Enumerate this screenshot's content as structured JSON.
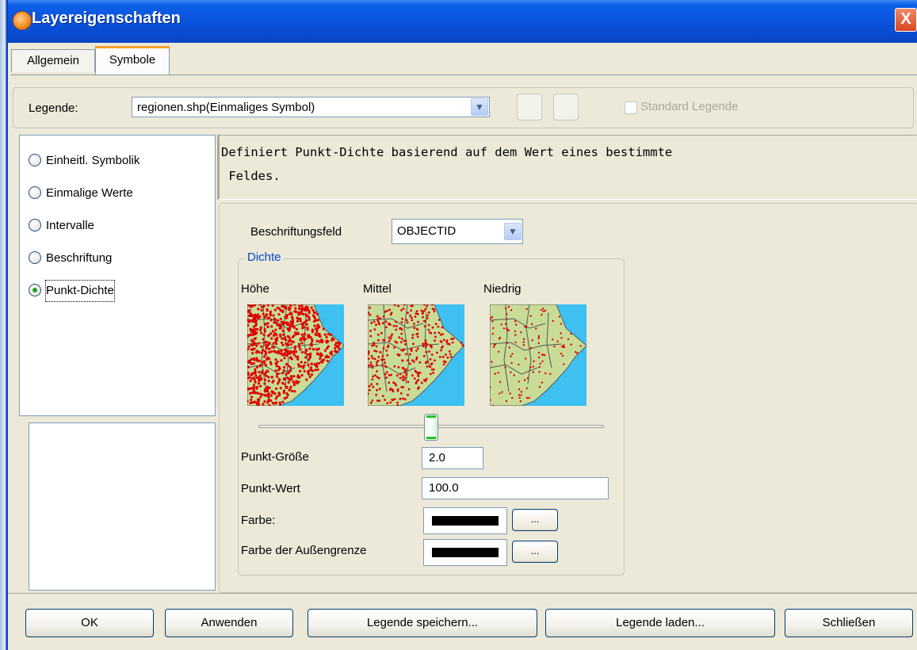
{
  "window": {
    "title": "Layereigenschaften",
    "close_glyph": "X"
  },
  "tabs": [
    {
      "label": "Allgemein"
    },
    {
      "label": "Symbole"
    }
  ],
  "legend": {
    "label": "Legende:",
    "value": "regionen.shp(Einmaliges Symbol)",
    "standard_label": "Standard Legende"
  },
  "symbol_types": [
    {
      "label": "Einheitl. Symbolik",
      "selected": false
    },
    {
      "label": "Einmalige Werte",
      "selected": false
    },
    {
      "label": "Intervalle",
      "selected": false
    },
    {
      "label": "Beschriftung",
      "selected": false
    },
    {
      "label": "Punkt-Dichte",
      "selected": true
    }
  ],
  "description": "Definiert Punkt-Dichte basierend auf dem Wert eines bestimmte\n Feldes.",
  "field": {
    "label": "Beschriftungsfeld",
    "value": "OBJECTID"
  },
  "density": {
    "group_title": "Dichte",
    "levels": [
      {
        "label": "Höhe"
      },
      {
        "label": "Mittel"
      },
      {
        "label": "Niedrig"
      }
    ],
    "slider_fraction": 0.5
  },
  "point_size": {
    "label": "Punkt-Größe",
    "value": "2.0"
  },
  "point_value": {
    "label": "Punkt-Wert",
    "value": "100.0"
  },
  "color": {
    "label": "Farbe:",
    "swatch": "#000000",
    "button": "..."
  },
  "outline_color": {
    "label": "Farbe der Außengrenze",
    "swatch": "#000000",
    "button": "..."
  },
  "buttons": {
    "ok": "OK",
    "apply": "Anwenden",
    "save_legend": "Legende speichern...",
    "load_legend": "Legende laden...",
    "close": "Schließen"
  },
  "colors": {
    "titlebar": "#0a50d8",
    "accent_tab": "#f1a02a",
    "group_title": "#0046d5",
    "map_water": "#3ec1f1",
    "map_land": "#c8dc98",
    "dots": "#e00000"
  }
}
